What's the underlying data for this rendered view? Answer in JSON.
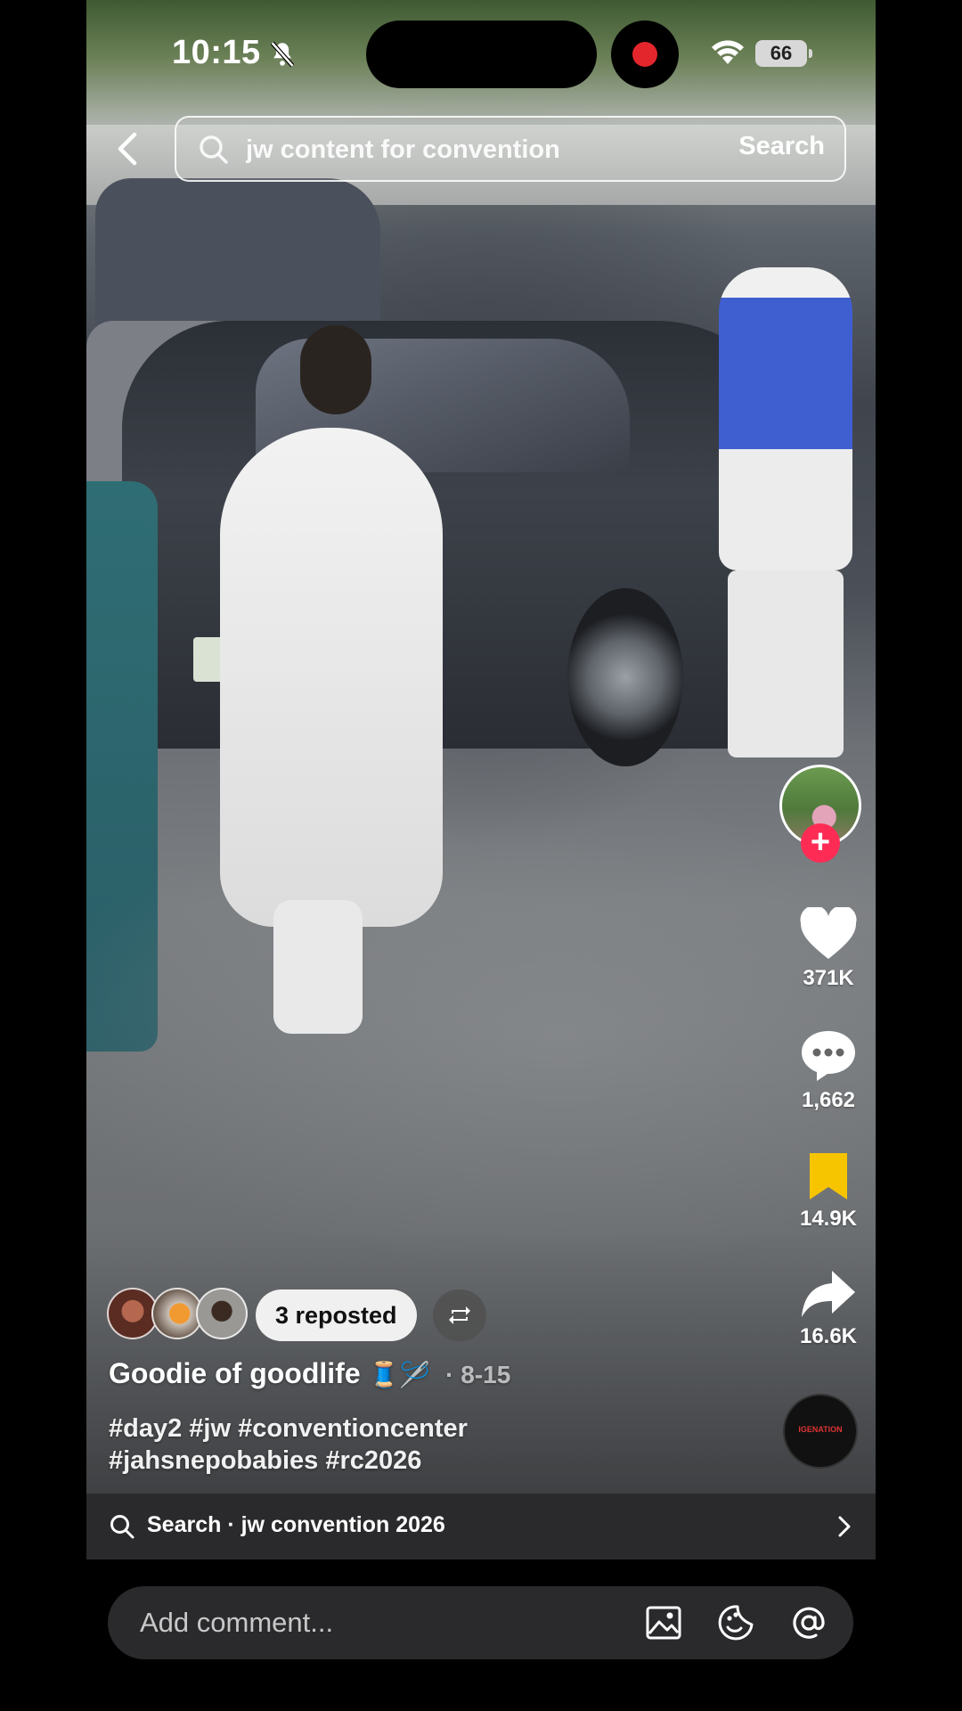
{
  "status_bar": {
    "time": "10:15",
    "battery": "66"
  },
  "search": {
    "query": "jw content for convention",
    "button_label": "Search"
  },
  "rail": {
    "likes": "371K",
    "comments": "1,662",
    "saves": "14.9K",
    "shares": "16.6K",
    "follow_symbol": "+",
    "sound_label": "IGENATION"
  },
  "post": {
    "repost_label": "3 reposted",
    "author": "Goodie of goodlife",
    "author_emoji": "🧵🪡",
    "date": "· 8-15",
    "hashtags": "#day2 #jw #conventioncenter #jahsnepobabies #rc2026"
  },
  "search_suggestion": {
    "text": "Search · jw convention 2026"
  },
  "comment": {
    "placeholder": "Add comment..."
  },
  "colors": {
    "accent": "#fe2c55",
    "save": "#f7c500",
    "panel": "#2a2a2c"
  }
}
